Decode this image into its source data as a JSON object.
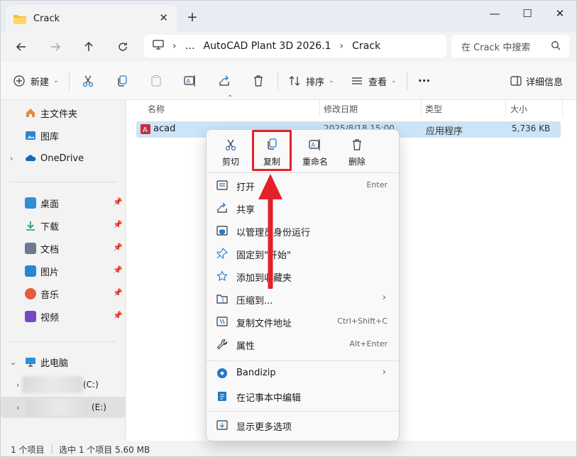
{
  "window": {
    "tab_title": "Crack",
    "tab_close": "✕",
    "new_tab": "+",
    "controls": {
      "minimize": "—",
      "maximize": "☐",
      "close": "✕"
    }
  },
  "address": {
    "segments": [
      "…",
      "AutoCAD Plant 3D 2026.1",
      "Crack"
    ],
    "chevron": "›",
    "search_placeholder": "在 Crack 中搜索"
  },
  "toolbar": {
    "new_label": "新建",
    "sort_label": "排序",
    "view_label": "查看",
    "more_label": "···",
    "details_label": "详细信息"
  },
  "sidebar": {
    "top_items": [
      {
        "label": "主文件夹",
        "icon": "home-icon"
      },
      {
        "label": "图库",
        "icon": "gallery-icon"
      },
      {
        "label": "OneDrive",
        "icon": "onedrive-icon"
      }
    ],
    "quick_access": [
      {
        "label": "桌面",
        "icon": "desktop-icon",
        "color": "#2f8fd5"
      },
      {
        "label": "下载",
        "icon": "download-icon",
        "color": "#1f9e5a"
      },
      {
        "label": "文档",
        "icon": "document-icon",
        "color": "#6b7a8f"
      },
      {
        "label": "图片",
        "icon": "pictures-icon",
        "color": "#2a86d1"
      },
      {
        "label": "音乐",
        "icon": "music-icon",
        "color": "#e55b3c"
      },
      {
        "label": "视频",
        "icon": "video-icon",
        "color": "#7a46c9"
      }
    ],
    "pin": "📌",
    "this_pc": "此电脑",
    "drives": [
      "(C:)",
      "(E:)"
    ]
  },
  "columns": {
    "name": "名称",
    "date": "修改日期",
    "type": "类型",
    "size": "大小"
  },
  "files": [
    {
      "name": "acad",
      "date": "2025/8/18 15:00",
      "type": "应用程序",
      "size": "5,736 KB"
    }
  ],
  "status": {
    "count": "1 个项目",
    "selected": "选中 1 个项目  5.60 MB"
  },
  "context_menu": {
    "quick_actions": [
      {
        "label": "剪切",
        "icon": "cut-icon"
      },
      {
        "label": "复制",
        "icon": "copy-icon"
      },
      {
        "label": "重命名",
        "icon": "rename-icon"
      },
      {
        "label": "删除",
        "icon": "delete-icon"
      }
    ],
    "items": [
      {
        "label": "打开",
        "shortcut": "Enter",
        "icon": "open-icon"
      },
      {
        "label": "共享",
        "shortcut": "",
        "icon": "share-icon"
      },
      {
        "label": "以管理员身份运行",
        "shortcut": "",
        "icon": "shield-icon"
      },
      {
        "label": "固定到\"开始\"",
        "shortcut": "",
        "icon": "pin-icon"
      },
      {
        "label": "添加到收藏夹",
        "shortcut": "",
        "icon": "star-icon"
      },
      {
        "label": "压缩到...",
        "shortcut": "",
        "icon": "zip-icon",
        "submenu": "›"
      },
      {
        "label": "复制文件地址",
        "shortcut": "Ctrl+Shift+C",
        "icon": "copy-path-icon"
      },
      {
        "label": "属性",
        "shortcut": "Alt+Enter",
        "icon": "wrench-icon"
      },
      {
        "label": "Bandizip",
        "shortcut": "",
        "icon": "bandizip-icon",
        "submenu": "›"
      },
      {
        "label": "在记事本中编辑",
        "shortcut": "",
        "icon": "notepad-icon"
      },
      {
        "label": "显示更多选项",
        "shortcut": "",
        "icon": "more-options-icon"
      }
    ]
  },
  "colors": {
    "accent": "#0067c0",
    "highlight": "#e3212b",
    "selection": "#cce4f7"
  }
}
